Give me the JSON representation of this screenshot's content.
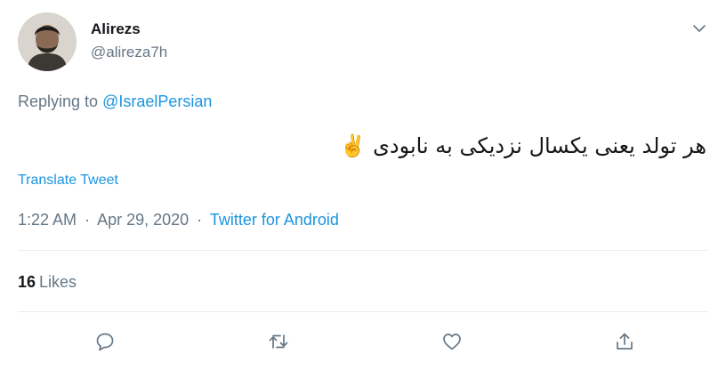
{
  "tweet": {
    "author": {
      "display_name": "Alirezs",
      "handle": "@alireza7h"
    },
    "reply": {
      "prefix": "Replying to",
      "mention": "@IsraelPersian"
    },
    "text": "هر تولد یعنی یکسال نزدیکی به نابودی",
    "emoji": "✌️",
    "translate_label": "Translate Tweet",
    "time": "1:22 AM",
    "date": "Apr 29, 2020",
    "separator": "·",
    "source": "Twitter for Android",
    "likes": {
      "count": "16",
      "label": "Likes"
    }
  },
  "colors": {
    "link": "#1b95e0",
    "muted": "#657786",
    "text": "#14171a",
    "divider": "#e6ecf0"
  },
  "icons": {
    "more": "chevron-down-icon",
    "reply": "speech-bubble-icon",
    "retweet": "retweet-icon",
    "like": "heart-icon",
    "share": "share-icon"
  }
}
